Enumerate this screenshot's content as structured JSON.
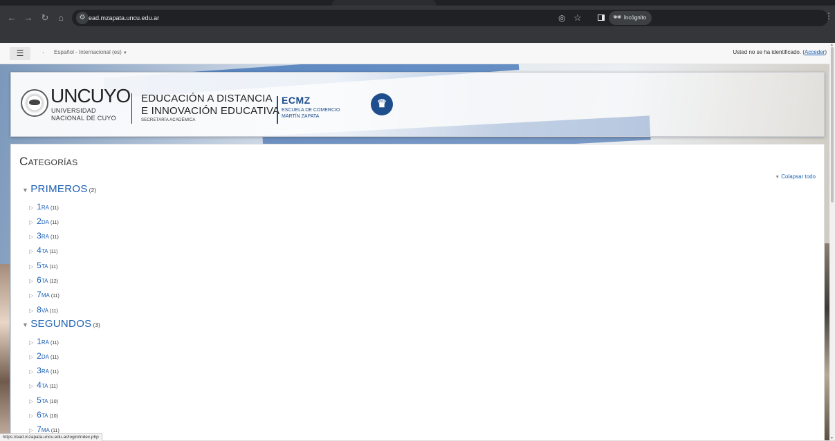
{
  "browser": {
    "url": "ead.mzapata.uncu.edu.ar",
    "incognito_label": "Incógnito",
    "icons": [
      "back-icon",
      "forward-icon",
      "reload-icon",
      "home-icon",
      "site-settings-icon",
      "eye-off-icon",
      "star-icon",
      "side-panel-icon",
      "incognito-icon",
      "kebab-menu-icon"
    ]
  },
  "topbar": {
    "menu_icon": "☰",
    "separator": ".",
    "language": "Español - Internacional (es)",
    "login_text": "Usted no se ha identificado. (",
    "login_link": "Acceder",
    "login_close": ")"
  },
  "header": {
    "uncuyo_title": "UNCUYO",
    "uncuyo_sub1": "UNIVERSIDAD",
    "uncuyo_sub2": "NACIONAL DE CUYO",
    "ead_line1": "EDUCACIÓN A DISTANCIA",
    "ead_line2": "E INNOVACIÓN EDUCATIVA",
    "ead_line3": "SECRETARÍA ACADÉMICA",
    "ecmz_title": "ECMZ",
    "ecmz_sub1": "ESCUELA DE COMERCIO",
    "ecmz_sub2": "MARTÍN ZAPATA"
  },
  "main": {
    "heading": "Categorías",
    "collapse_all": "Colapsar todo",
    "categories": [
      {
        "name": "PRIMEROS",
        "count": "(2)",
        "children": [
          {
            "name": "1ra",
            "count": "(11)"
          },
          {
            "name": "2da",
            "count": "(11)"
          },
          {
            "name": "3ra",
            "count": "(11)"
          },
          {
            "name": "4ta",
            "count": "(11)"
          },
          {
            "name": "5ta",
            "count": "(11)"
          },
          {
            "name": "6ta",
            "count": "(12)"
          },
          {
            "name": "7ma",
            "count": "(11)"
          },
          {
            "name": "8va",
            "count": "(11)"
          }
        ]
      },
      {
        "name": "SEGUNDOS",
        "count": "(3)",
        "children": [
          {
            "name": "1ra",
            "count": "(11)"
          },
          {
            "name": "2da",
            "count": "(11)"
          },
          {
            "name": "3ra",
            "count": "(11)"
          },
          {
            "name": "4ta",
            "count": "(11)"
          },
          {
            "name": "5ta",
            "count": "(10)"
          },
          {
            "name": "6ta",
            "count": "(10)"
          },
          {
            "name": "7ma",
            "count": "(11)"
          }
        ]
      }
    ]
  },
  "status_bar": {
    "url": "https://ead.mzapata.uncu.edu.ar/login/index.php"
  },
  "colors": {
    "link": "#1a5fb4",
    "brand_blue": "#1f4e8c",
    "chrome_bg": "#35363a"
  }
}
